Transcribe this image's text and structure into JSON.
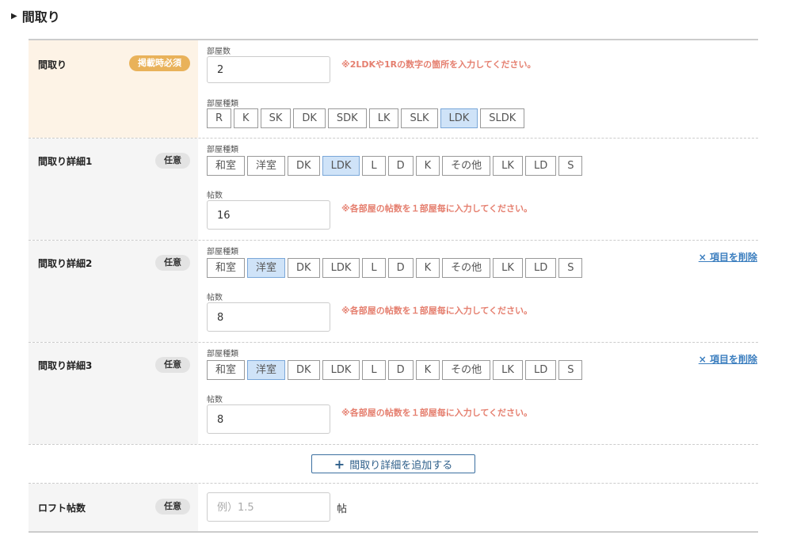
{
  "section": {
    "title": "間取り"
  },
  "badges": {
    "required": "掲載時必須",
    "optional": "任意"
  },
  "madori": {
    "title": "間取り",
    "rooms_label": "部屋数",
    "rooms_value": "2",
    "rooms_hint": "※2LDKや1Rの数字の箇所を入力してください。",
    "type_label": "部屋種類",
    "types": [
      "R",
      "K",
      "SK",
      "DK",
      "SDK",
      "LK",
      "SLK",
      "LDK",
      "SLDK"
    ],
    "selected": "LDK"
  },
  "detail_types": [
    "和室",
    "洋室",
    "DK",
    "LDK",
    "L",
    "D",
    "K",
    "その他",
    "LK",
    "LD",
    "S"
  ],
  "details": [
    {
      "title": "間取り詳細1",
      "type_label": "部屋種類",
      "selected": "LDK",
      "size_label": "帖数",
      "size_value": "16",
      "hint": "※各部屋の帖数を１部屋毎に入力してください。"
    },
    {
      "title": "間取り詳細2",
      "type_label": "部屋種類",
      "selected": "洋室",
      "size_label": "帖数",
      "size_value": "8",
      "hint": "※各部屋の帖数を１部屋毎に入力してください。",
      "delete": "× 項目を削除"
    },
    {
      "title": "間取り詳細3",
      "type_label": "部屋種類",
      "selected": "洋室",
      "size_label": "帖数",
      "size_value": "8",
      "hint": "※各部屋の帖数を１部屋毎に入力してください。",
      "delete": "× 項目を削除"
    }
  ],
  "add_button": "間取り詳細を追加する",
  "loft": {
    "title": "ロフト帖数",
    "placeholder": "例）1.5",
    "unit": "帖"
  },
  "colors": {
    "required_badge": "#e9b25a",
    "hint": "#e57f6f",
    "link": "#3b7ebf",
    "selected_chip": "#cfe3f8"
  }
}
